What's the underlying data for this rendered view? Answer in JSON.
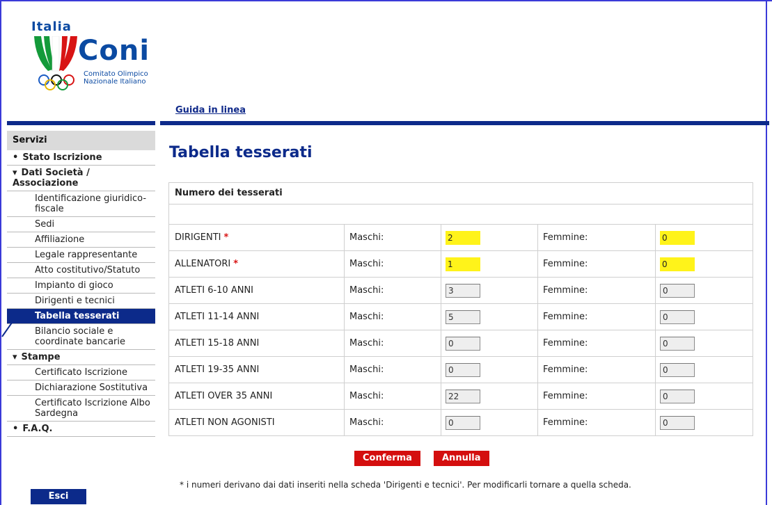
{
  "brand": {
    "country": "Italia",
    "name": "Coni",
    "subtitle_line1": "Comitato Olimpico",
    "subtitle_line2": "Nazionale Italiano"
  },
  "header": {
    "help_link": "Guida in linea"
  },
  "sidebar": {
    "title": "Servizi",
    "items": [
      {
        "label": "Stato Iscrizione",
        "kind": "top",
        "marker": "•"
      },
      {
        "label": "Dati Società / Associazione",
        "kind": "top",
        "marker": "▾"
      },
      {
        "label": "Identificazione giuridico-fiscale",
        "kind": "sub"
      },
      {
        "label": "Sedi",
        "kind": "sub"
      },
      {
        "label": "Affiliazione",
        "kind": "sub"
      },
      {
        "label": "Legale rappresentante",
        "kind": "sub"
      },
      {
        "label": "Atto costitutivo/Statuto",
        "kind": "sub"
      },
      {
        "label": "Impianto di gioco",
        "kind": "sub"
      },
      {
        "label": "Dirigenti e tecnici",
        "kind": "sub"
      },
      {
        "label": "Tabella tesserati",
        "kind": "sub",
        "active": true
      },
      {
        "label": "Bilancio sociale e coordinate bancarie",
        "kind": "sub"
      },
      {
        "label": "Stampe",
        "kind": "top",
        "marker": "▾"
      },
      {
        "label": "Certificato Iscrizione",
        "kind": "sub"
      },
      {
        "label": "Dichiarazione Sostitutiva",
        "kind": "sub"
      },
      {
        "label": "Certificato Iscrizione Albo Sardegna",
        "kind": "sub"
      },
      {
        "label": "F.A.Q.",
        "kind": "top",
        "marker": "•"
      }
    ],
    "exit_label": "Esci"
  },
  "main": {
    "title": "Tabella tesserati",
    "table_header": "Numero dei tesserati",
    "male_label": "Maschi:",
    "female_label": "Femmine:",
    "rows": [
      {
        "label": "DIRIGENTI",
        "required": true,
        "maschi": "2",
        "femmine": "0",
        "highlight": true
      },
      {
        "label": "ALLENATORI",
        "required": true,
        "maschi": "1",
        "femmine": "0",
        "highlight": true
      },
      {
        "label": "ATLETI 6-10 ANNI",
        "required": false,
        "maschi": "3",
        "femmine": "0"
      },
      {
        "label": "ATLETI 11-14 ANNI",
        "required": false,
        "maschi": "5",
        "femmine": "0"
      },
      {
        "label": "ATLETI 15-18 ANNI",
        "required": false,
        "maschi": "0",
        "femmine": "0"
      },
      {
        "label": "ATLETI 19-35 ANNI",
        "required": false,
        "maschi": "0",
        "femmine": "0"
      },
      {
        "label": "ATLETI OVER 35 ANNI",
        "required": false,
        "maschi": "22",
        "femmine": "0"
      },
      {
        "label": "ATLETI NON AGONISTI",
        "required": false,
        "maschi": "0",
        "femmine": "0"
      }
    ],
    "required_marker": "*",
    "confirm_label": "Conferma",
    "cancel_label": "Annulla",
    "note": "* i numeri derivano dai dati inseriti nella scheda 'Dirigenti e tecnici'. Per modificarli tornare a quella scheda."
  },
  "colors": {
    "navy": "#0c2a8a",
    "red_button": "#d40e0e",
    "highlight_yellow": "#fff31a"
  }
}
